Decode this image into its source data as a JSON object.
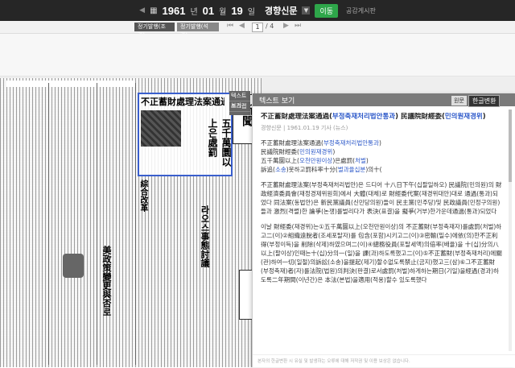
{
  "topbar": {
    "year": "1961",
    "month": "01",
    "day": "19",
    "newspaper": "경향신문",
    "go_label": "이동",
    "board_link": "공감게시판"
  },
  "pagebar": {
    "tabs": [
      "정기발행(조간)",
      "정기발행(석간)"
    ],
    "current_page": "1",
    "total_pages": "/ 4"
  },
  "viewer_tabs": [
    "텍스트 보기",
    "스크랩"
  ],
  "clipping": {
    "headline": "不正蓄財處理法案通過",
    "vertical_1": "五千萬圜以上은處罰",
    "vertical_2": "라오스事態討議",
    "vertical_3": "美政策變更與否로"
  },
  "panel": {
    "header": "텍스트 보기",
    "original_btn": "원문",
    "convert_btn": "한글변환",
    "title_prefix": "不正蓄財處理法案通過(",
    "title_link1": "부정축재처리법안통과",
    "title_mid": ") 民議院財經委(",
    "title_link2": "민의원재경위",
    "title_suffix": ")",
    "meta": "경향신문 | 1961.01.19 기사 (뉴스)",
    "para1": [
      [
        "不正蓄財處理法案通過(",
        "부정축재처리법안통과",
        ")"
      ],
      [
        "民議院財經委(",
        "민의원재경위",
        ")"
      ],
      [
        "五千萬圜以上(",
        "오천만원이상",
        ")은處罰(",
        "처벌",
        ")"
      ],
      [
        "訴追(",
        "소송",
        ")못하고罰科率十分(",
        "벌과율십분",
        ")의十(",
        "십",
        ")"
      ]
    ],
    "para2": "不正蓄財處理法案(부정축재처리법안)은 드디어 十八日下午(십팔일하오) 民議院(민의원)의 財政經濟委員會(재정경제위원회)에서 大體(대체)로 財經委代案(재경위대안)대로 通過(통과)되었다 同法案(동법안)은 新民黨議員(신민당의원)들이 民主黨(민주당)및 民政議員(민정구의원)들과 激烈(격렬)한 論爭(논쟁)를벌리다가 表決(표결)을 擬爭(거부)한가운데通過(통과)되었다",
    "para3": "이날 財經委(재경위)는①五千萬圜以上(오천만원이상)의 不正蓄財(부정축재자)를處罰(처벌)하고二(이)②組織遠脫者(조세포탈자)를 包含(포함)시키고二(이)③密輸(밀수)에依(의)한不正利得(부정이득)을 削除(삭제)하였으며二(이)④總務役員(포탈세액)의倍率(배율)을 十(십)分의八以上(팔이상)인때는十(십)分의一(일)을 課(과)하도록했고二(이)⑤不正蓄財(부정축재처리)에關(관)하여一切(일절)의訴訟(소송)을提起(제기)할수없도록禁止(금지)했고三(삼)⑥그不正蓄財(부정축재)者(자)를法院(법원)의判決(판결)로서處罰(처벌)하게하는期日(기일)을經過(경과)하도록二年期間(이년간)은 本法(본법)을適用(적용)할수 있도록했다",
    "footer": "본자의 한글변환 시 유실 및 발생하는 오류에 대해 저작권 및 이용 보상은 없습니다."
  }
}
